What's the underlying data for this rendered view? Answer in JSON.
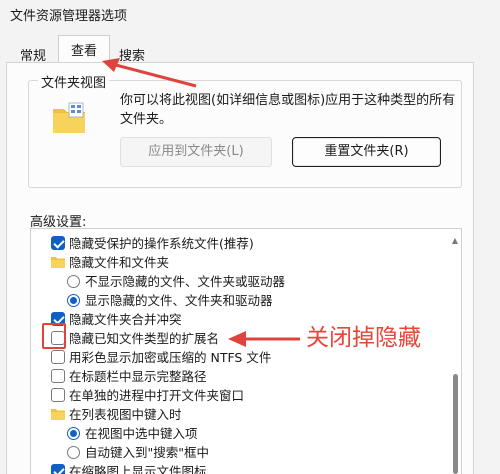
{
  "window": {
    "title": "文件资源管理器选项"
  },
  "tabs": [
    {
      "label": "常规"
    },
    {
      "label": "查看"
    },
    {
      "label": "搜索"
    }
  ],
  "folder_view": {
    "title": "文件夹视图",
    "description_line1": "你可以将此视图(如详细信息或图标)应用于这种类型的所有",
    "description_line2": "文件夹。",
    "apply_label": "应用到文件夹(L)",
    "reset_label": "重置文件夹(R)"
  },
  "advanced": {
    "label": "高级设置:",
    "items": [
      {
        "kind": "checkbox",
        "checked": true,
        "label": "隐藏受保护的操作系统文件(推荐)"
      },
      {
        "kind": "folder",
        "label": "隐藏文件和文件夹"
      },
      {
        "kind": "radio",
        "checked": false,
        "label": "不显示隐藏的文件、文件夹或驱动器"
      },
      {
        "kind": "radio",
        "checked": true,
        "label": "显示隐藏的文件、文件夹和驱动器"
      },
      {
        "kind": "checkbox",
        "checked": true,
        "label": "隐藏文件夹合并冲突"
      },
      {
        "kind": "checkbox",
        "checked": false,
        "label": "隐藏已知文件类型的扩展名"
      },
      {
        "kind": "checkbox",
        "checked": false,
        "label": "用彩色显示加密或压缩的 NTFS 文件"
      },
      {
        "kind": "checkbox",
        "checked": false,
        "label": "在标题栏中显示完整路径"
      },
      {
        "kind": "checkbox",
        "checked": false,
        "label": "在单独的进程中打开文件夹窗口"
      },
      {
        "kind": "folder",
        "label": "在列表视图中键入时"
      },
      {
        "kind": "radio",
        "checked": true,
        "label": "在视图中选中键入项"
      },
      {
        "kind": "radio",
        "checked": false,
        "label": "自动键入到\"搜索\"框中"
      },
      {
        "kind": "checkbox",
        "checked": true,
        "label": "在缩略图上显示文件图标"
      }
    ]
  },
  "annotation": {
    "text": "关闭掉隐藏",
    "color": "#e8453c"
  },
  "colors": {
    "accent": "#0f5fc4",
    "annotation": "#e8453c"
  }
}
